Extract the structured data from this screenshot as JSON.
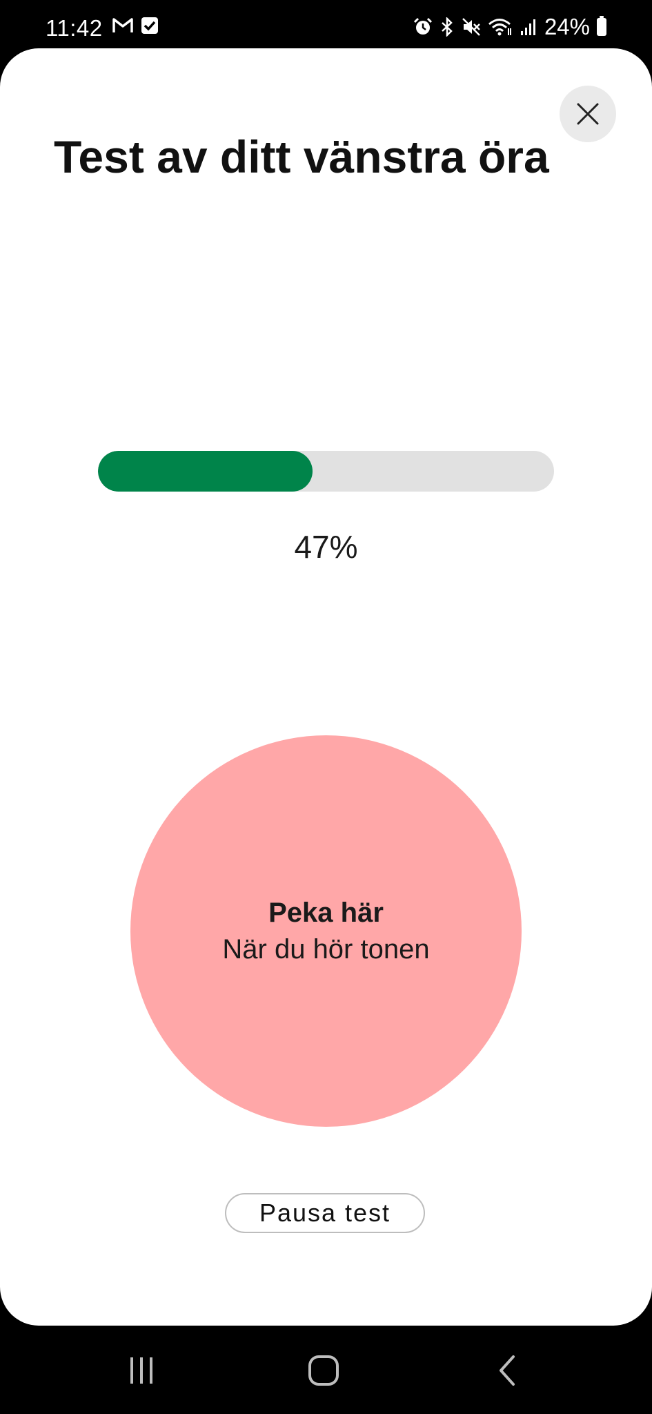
{
  "status_bar": {
    "time": "11:42",
    "battery": "24%",
    "left_icons": [
      "gmail-icon",
      "checkbox-icon"
    ],
    "right_icons": [
      "alarm-icon",
      "bluetooth-icon",
      "mute-icon",
      "wifi-icon",
      "signal-icon",
      "battery-icon"
    ]
  },
  "screen": {
    "title": "Test av ditt vänstra öra",
    "progress_value": 47,
    "progress_label": "47%",
    "tap_area": {
      "title": "Peka här",
      "subtitle": "När du hör tonen"
    },
    "pause_button": "Pausa test"
  },
  "colors": {
    "progress_fill": "#00844a",
    "progress_track": "#e1e1e1",
    "tap_circle": "#ffa7a8",
    "close_bg": "#eaeaea"
  },
  "nav_bar": {
    "buttons": [
      "recent-apps-icon",
      "home-icon",
      "back-icon"
    ]
  }
}
